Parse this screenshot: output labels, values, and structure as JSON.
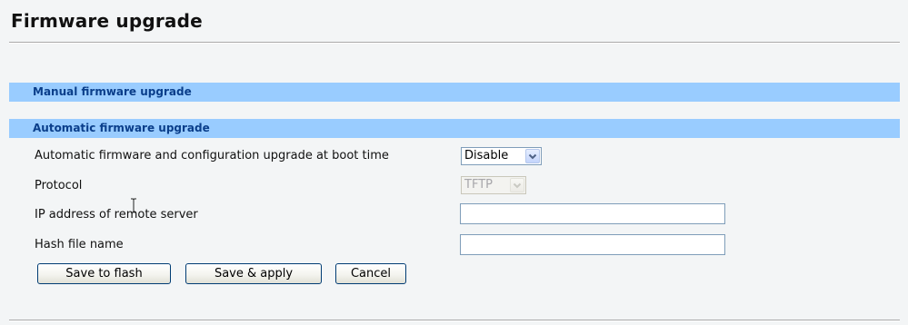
{
  "page": {
    "title": "Firmware upgrade"
  },
  "sections": {
    "manual_label": "Manual firmware upgrade",
    "automatic_label": "Automatic firmware upgrade"
  },
  "form": {
    "boot_upgrade": {
      "label": "Automatic firmware and configuration upgrade at boot time",
      "selected": "Disable"
    },
    "protocol": {
      "label": "Protocol",
      "selected": "TFTP",
      "disabled": true
    },
    "server_ip": {
      "label": "IP address of remote server",
      "value": ""
    },
    "hash_file": {
      "label": "Hash file name",
      "value": ""
    }
  },
  "buttons": {
    "save_to_flash": "Save to flash",
    "save_apply": "Save & apply",
    "cancel": "Cancel"
  },
  "colors": {
    "section_bar": "#99ccff",
    "section_text": "#0a3e8a",
    "page_background": "#f3f5f6"
  },
  "icons": {
    "select_arrow": "chevron-down-icon",
    "cursor": "text-cursor-icon"
  }
}
